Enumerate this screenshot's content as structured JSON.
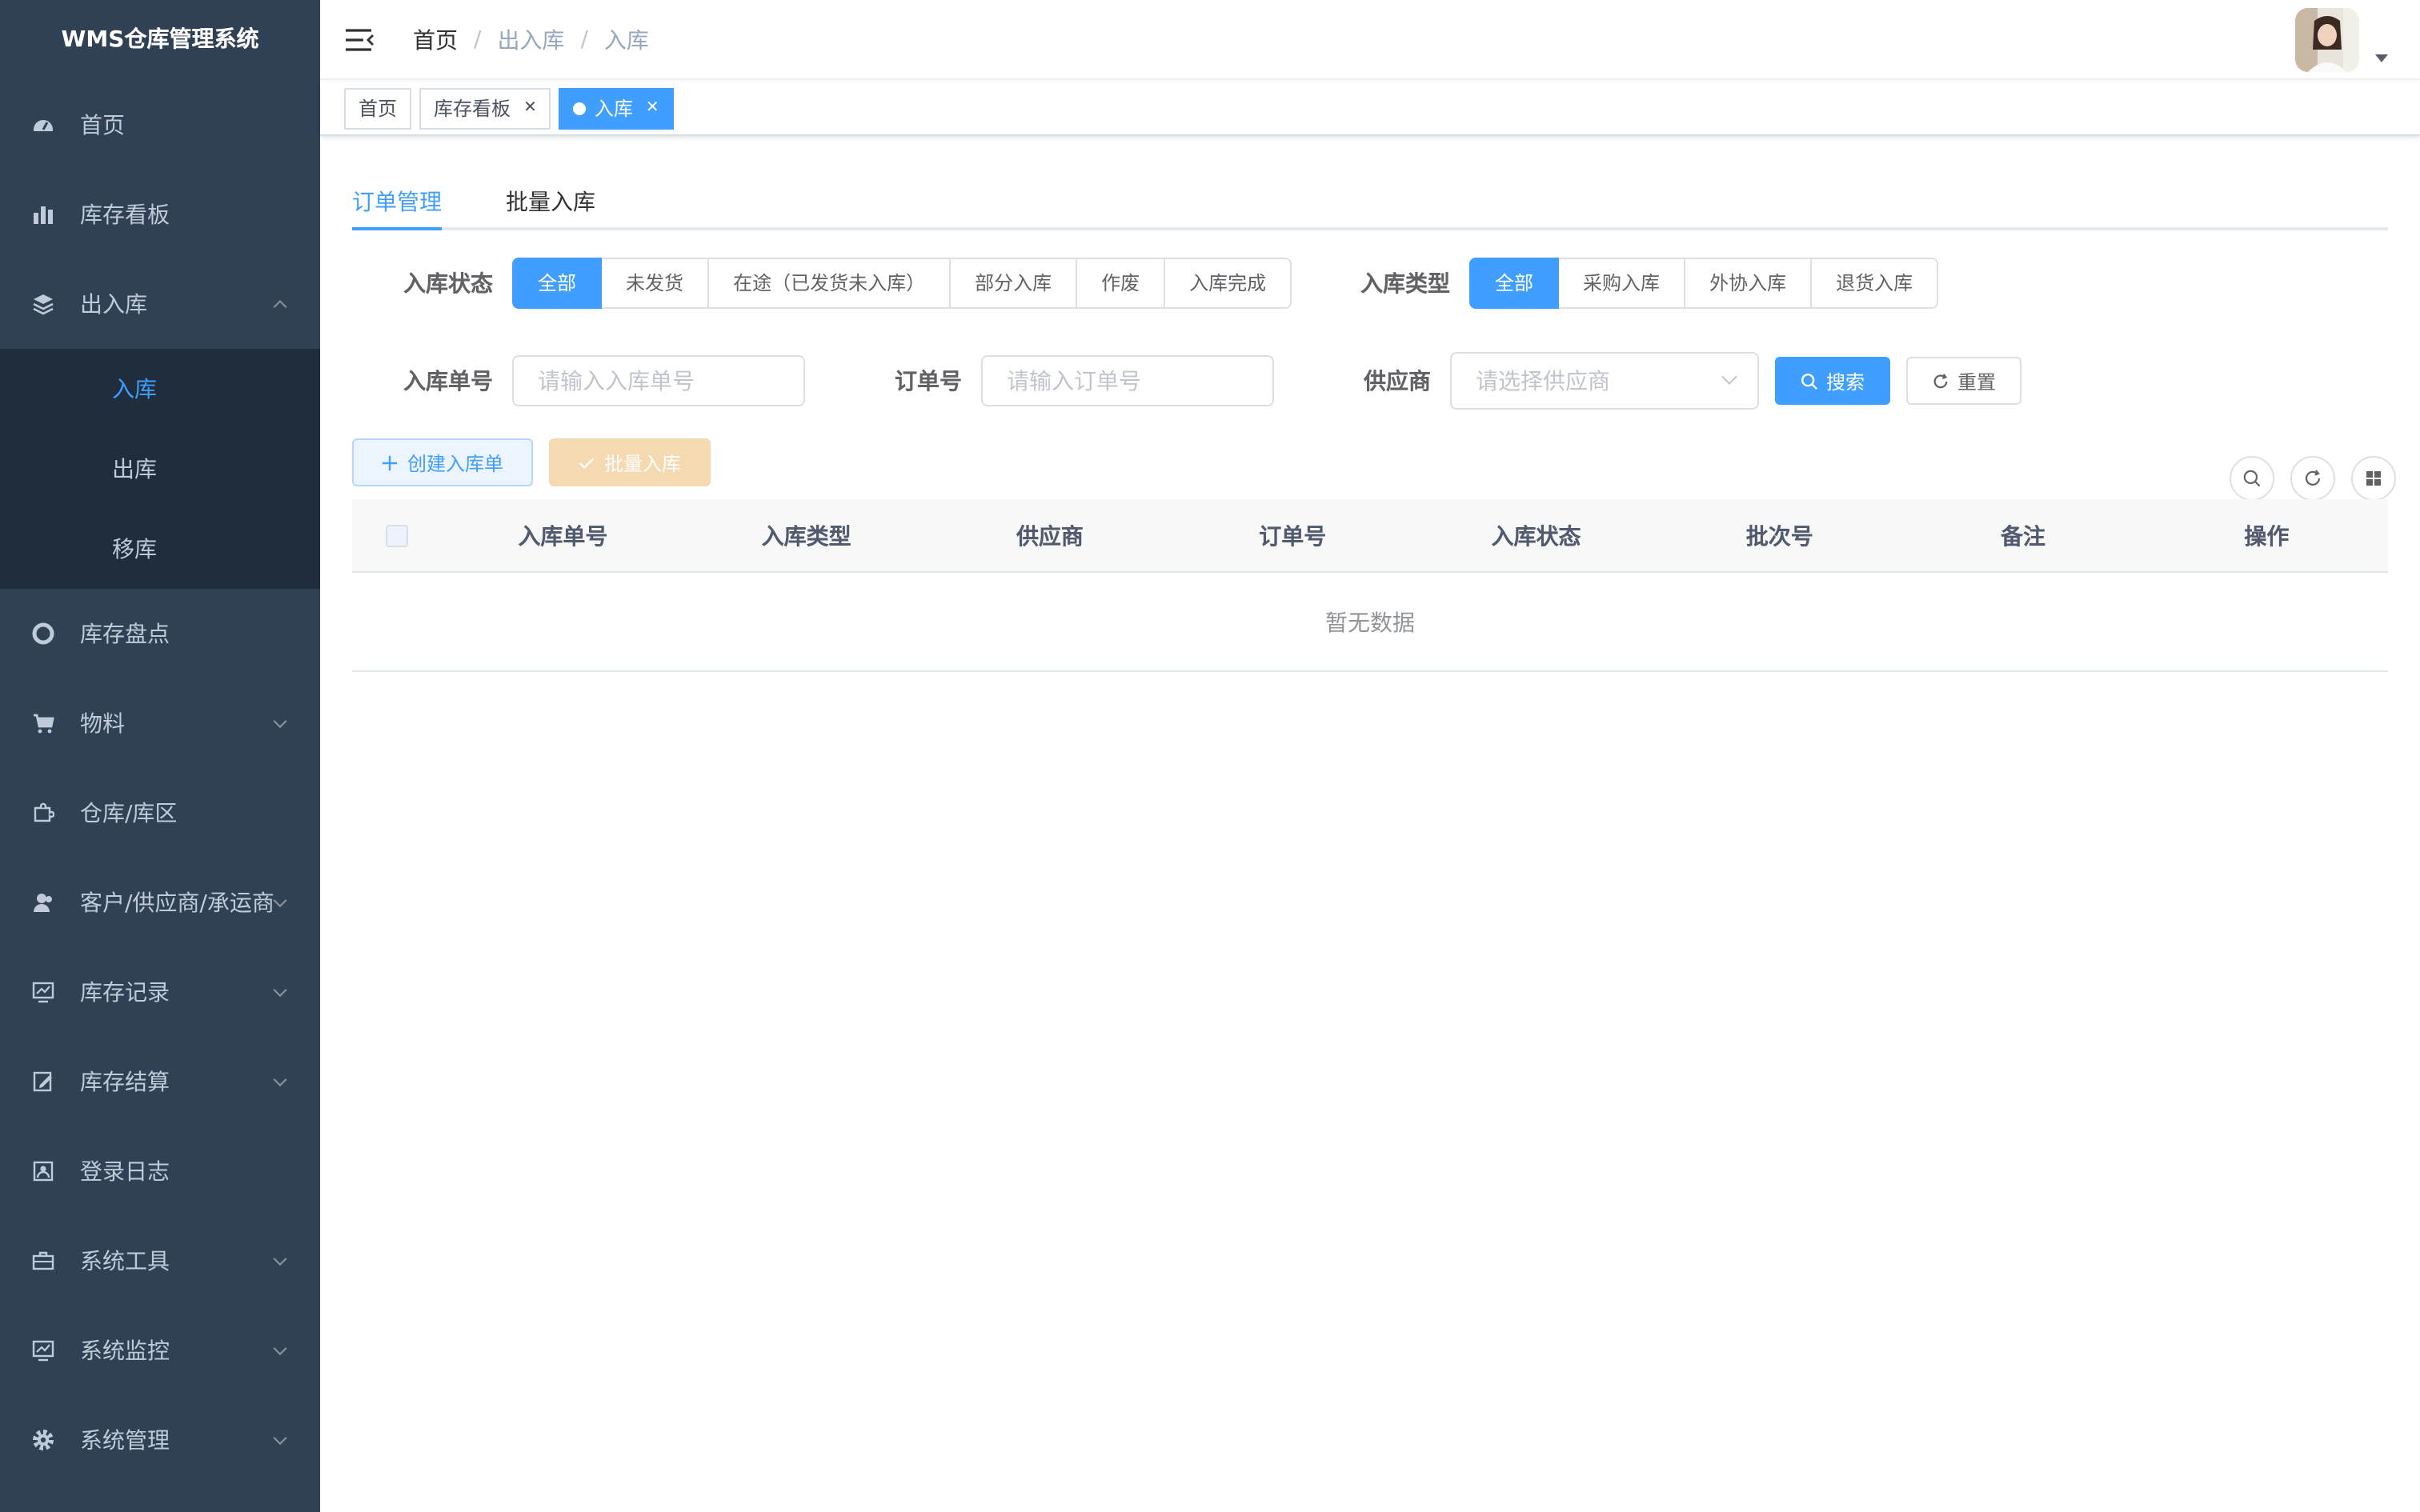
{
  "app": {
    "title": "WMS仓库管理系统"
  },
  "sidebar": {
    "items": [
      {
        "label": "首页",
        "icon": "dashboard-icon"
      },
      {
        "label": "库存看板",
        "icon": "bar-chart-icon"
      },
      {
        "label": "出入库",
        "icon": "layers-icon",
        "expanded": true,
        "children": [
          {
            "label": "入库",
            "active": true
          },
          {
            "label": "出库"
          },
          {
            "label": "移库"
          }
        ]
      },
      {
        "label": "库存盘点",
        "icon": "lifebuoy-icon"
      },
      {
        "label": "物料",
        "icon": "cart-icon",
        "has_children": true
      },
      {
        "label": "仓库/库区",
        "icon": "puzzle-icon"
      },
      {
        "label": "客户/供应商/承运商",
        "icon": "user-icon",
        "has_children": true
      },
      {
        "label": "库存记录",
        "icon": "monitor-chart-icon",
        "has_children": true
      },
      {
        "label": "库存结算",
        "icon": "edit-doc-icon",
        "has_children": true
      },
      {
        "label": "登录日志",
        "icon": "id-card-icon"
      },
      {
        "label": "系统工具",
        "icon": "toolbox-icon",
        "has_children": true
      },
      {
        "label": "系统监控",
        "icon": "monitor-icon",
        "has_children": true
      },
      {
        "label": "系统管理",
        "icon": "gear-icon",
        "has_children": true
      }
    ]
  },
  "header": {
    "breadcrumb": [
      "首页",
      "出入库",
      "入库"
    ]
  },
  "tags": [
    {
      "label": "首页",
      "closable": false,
      "active": false
    },
    {
      "label": "库存看板",
      "closable": true,
      "active": false
    },
    {
      "label": "入库",
      "closable": true,
      "active": true
    }
  ],
  "tabs": {
    "order": "订单管理",
    "batch": "批量入库"
  },
  "filters": {
    "status_label": "入库状态",
    "status_options": [
      "全部",
      "未发货",
      "在途（已发货未入库）",
      "部分入库",
      "作废",
      "入库完成"
    ],
    "status_selected": "全部",
    "type_label": "入库类型",
    "type_options": [
      "全部",
      "采购入库",
      "外协入库",
      "退货入库"
    ],
    "type_selected": "全部",
    "receipt_no_label": "入库单号",
    "receipt_no_placeholder": "请输入入库单号",
    "order_no_label": "订单号",
    "order_no_placeholder": "请输入订单号",
    "supplier_label": "供应商",
    "supplier_placeholder": "请选择供应商",
    "search_btn": "搜索",
    "reset_btn": "重置"
  },
  "toolbar": {
    "create_btn": "创建入库单",
    "batch_btn": "批量入库"
  },
  "table": {
    "columns": [
      "入库单号",
      "入库类型",
      "供应商",
      "订单号",
      "入库状态",
      "批次号",
      "备注",
      "操作"
    ],
    "rows": [],
    "empty_text": "暂无数据"
  },
  "colors": {
    "primary": "#409eff",
    "sidebar_bg": "#304156",
    "submenu_bg": "#1f2d3d",
    "warning_light": "#f5dab1"
  }
}
